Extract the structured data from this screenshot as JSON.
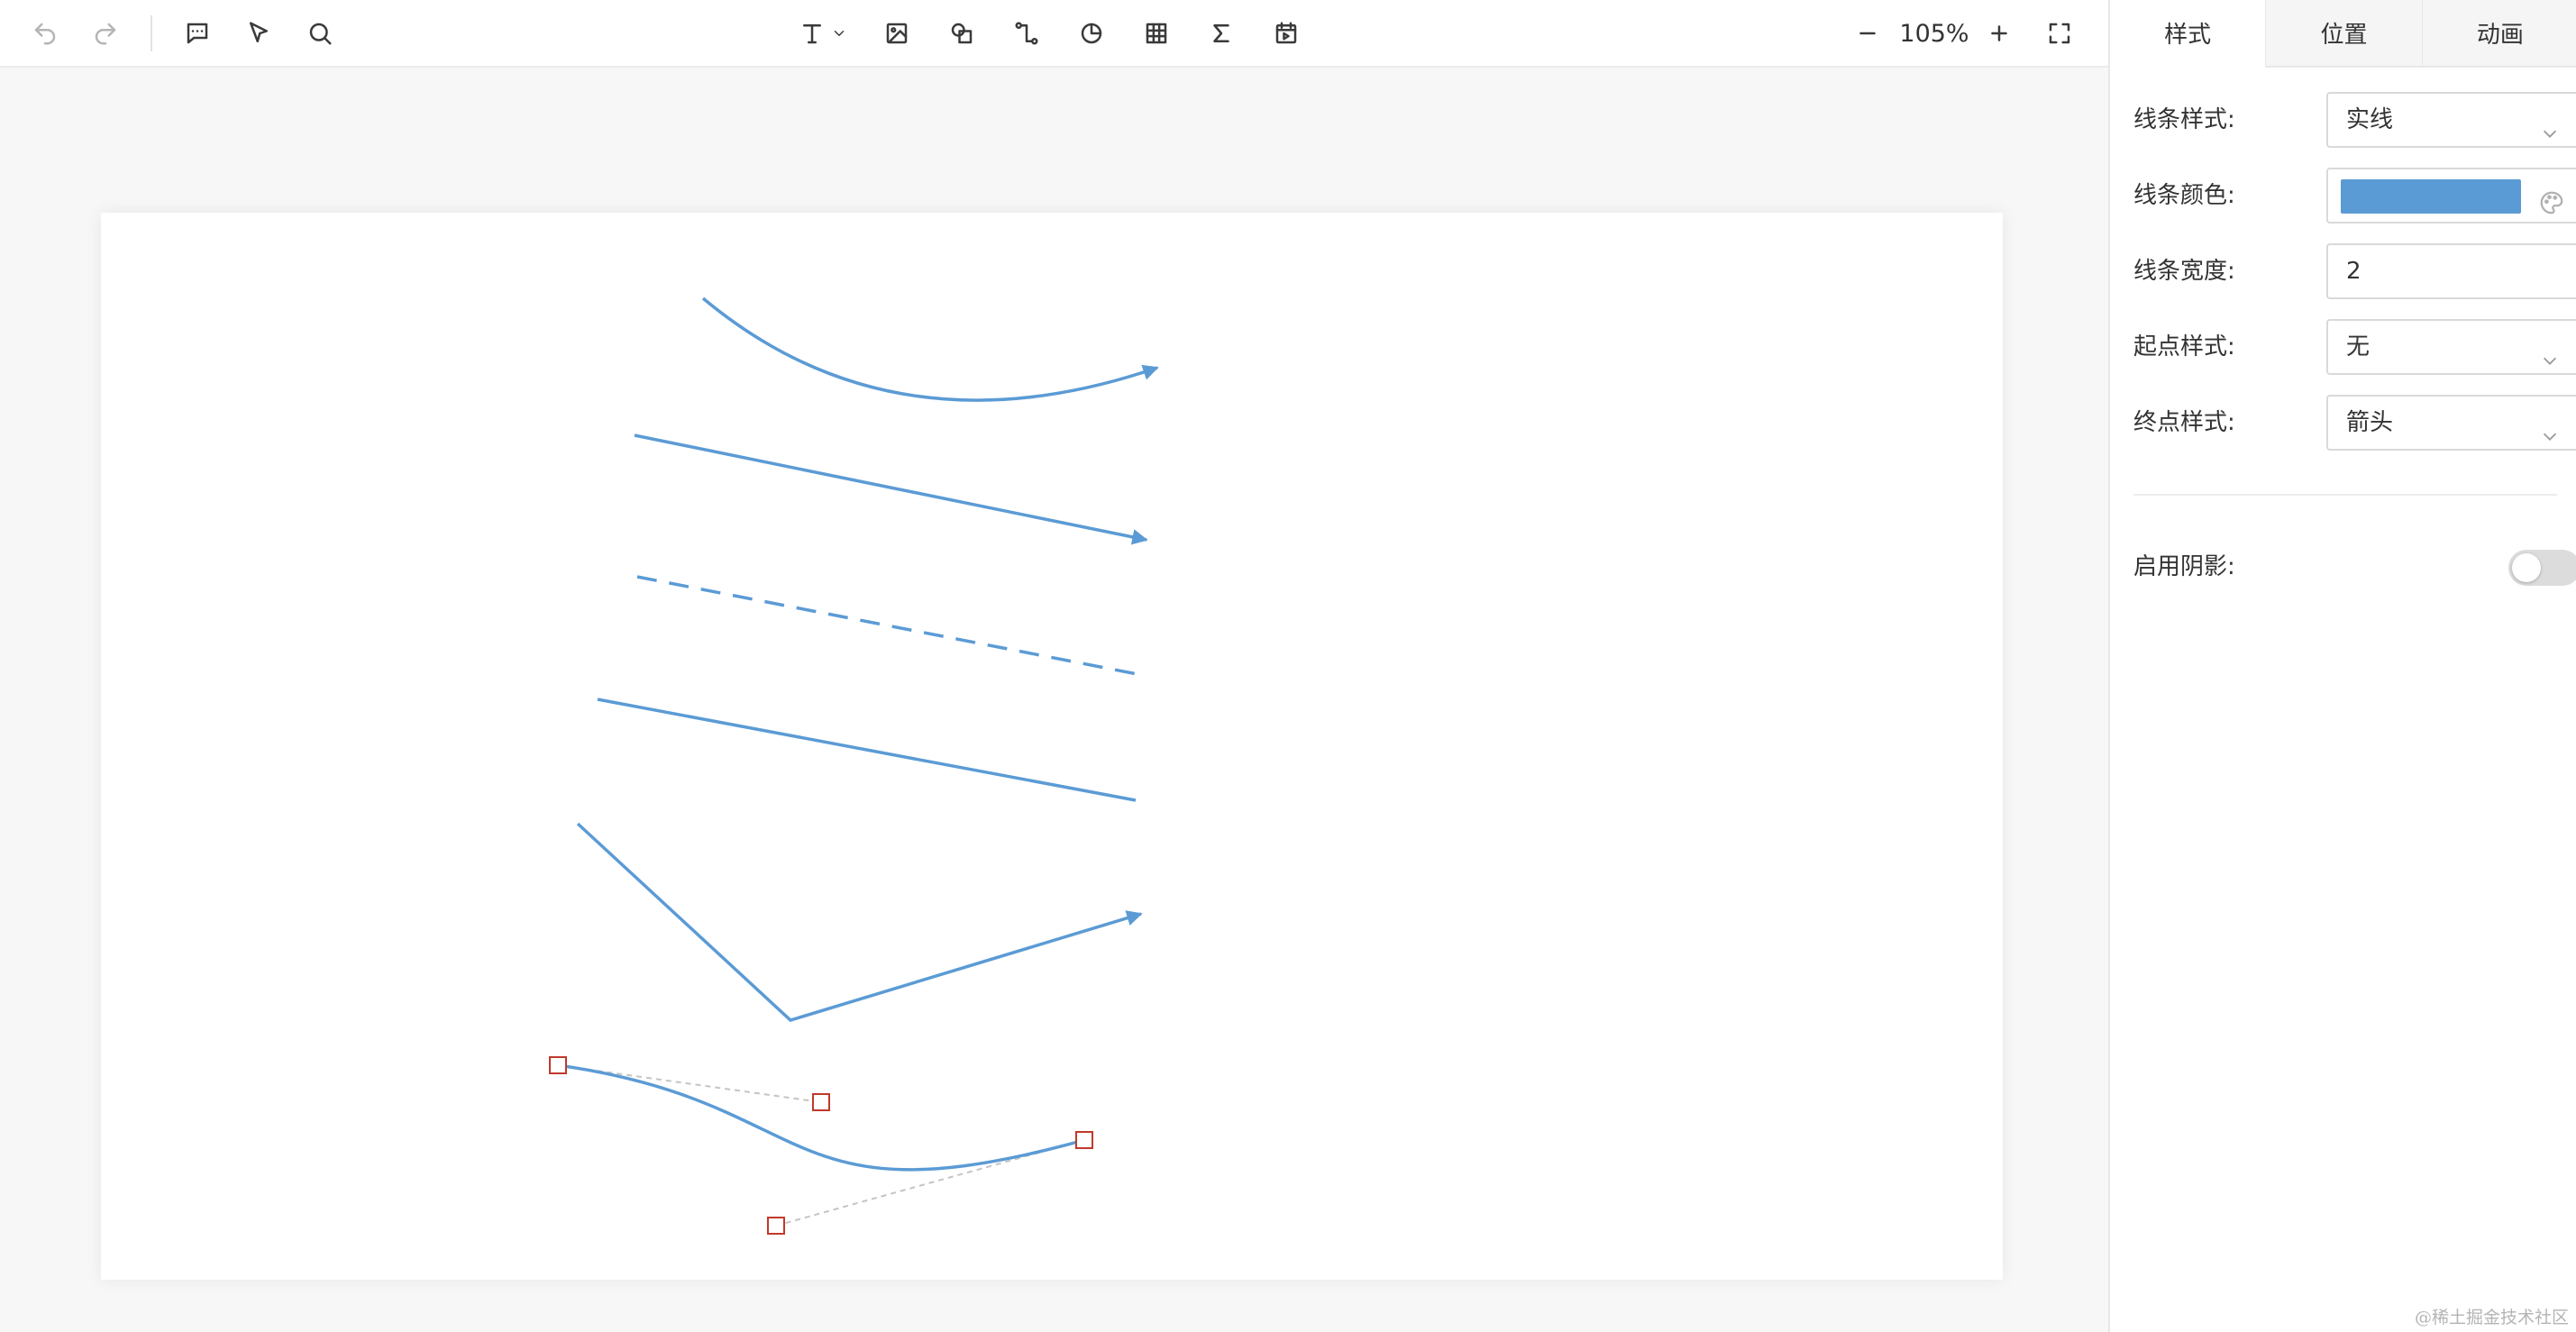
{
  "toolbar": {
    "left_tools": [
      "undo-icon",
      "redo-icon",
      "comment-icon",
      "pointer-icon",
      "search-icon"
    ],
    "insert_tools": [
      "text-icon",
      "image-icon",
      "shape-icon",
      "connector-icon",
      "chart-icon",
      "table-icon",
      "formula-icon",
      "media-icon"
    ],
    "zoom": {
      "value": "105%"
    }
  },
  "panel": {
    "tabs": [
      "样式",
      "位置",
      "动画"
    ],
    "active_tab": "样式",
    "line_style": {
      "label": "线条样式:",
      "value": "实线"
    },
    "line_color": {
      "label": "线条颜色:",
      "color": "#5b9bd5"
    },
    "line_width": {
      "label": "线条宽度:",
      "value": "2"
    },
    "start_style": {
      "label": "起点样式:",
      "value": "无"
    },
    "end_style": {
      "label": "终点样式:",
      "value": "箭头"
    },
    "shadow": {
      "label": "启用阴影:",
      "enabled": false
    }
  },
  "canvas": {
    "line_color": "#5b9bd5",
    "handle_color": "#c0392b"
  },
  "watermark": "@稀土掘金技术社区"
}
